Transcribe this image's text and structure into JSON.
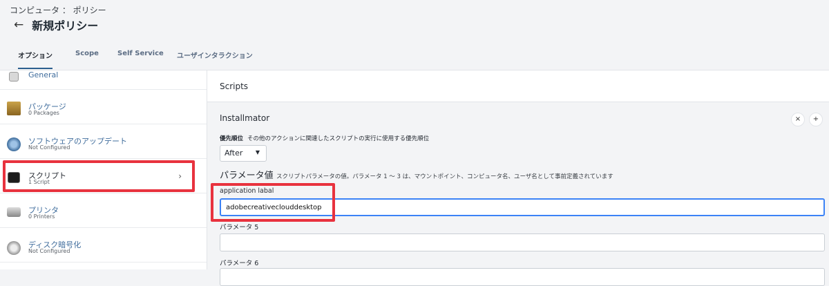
{
  "header": {
    "breadcrumb": "コンピュータ ： ポリシー",
    "back_icon": "←",
    "title": "新規ポリシー"
  },
  "tabs": [
    {
      "label": "オプション",
      "active": true
    },
    {
      "label": "Scope",
      "active": false
    },
    {
      "label": "Self Service",
      "active": false
    },
    {
      "label": "ユーザインタラクション",
      "active": false
    }
  ],
  "sidebar": {
    "items": [
      {
        "title": "General",
        "subtitle": "",
        "icon": "general-icon"
      },
      {
        "title": "パッケージ",
        "subtitle": "0 Packages",
        "icon": "package-icon"
      },
      {
        "title": "ソフトウェアのアップデート",
        "subtitle": "Not Configured",
        "icon": "software-update-icon"
      },
      {
        "title": "スクリプト",
        "subtitle": "1 Script",
        "icon": "terminal-icon",
        "selected": true
      },
      {
        "title": "プリンタ",
        "subtitle": "0 Printers",
        "icon": "printer-icon"
      },
      {
        "title": "ディスク暗号化",
        "subtitle": "Not Configured",
        "icon": "disk-encryption-icon"
      }
    ],
    "chevron": "›"
  },
  "main": {
    "section_title": "Scripts",
    "script_name": "Installmator",
    "close_symbol": "×",
    "add_symbol": "+",
    "priority_label": "優先順位",
    "priority_desc": "その他のアクションに関連したスクリプトの実行に使用する優先順位",
    "priority_value": "After",
    "caret": "▼",
    "params_heading": "パラメータ値",
    "params_desc": "スクリプトパラメータの値。パラメータ 1 〜 3 は、マウントポイント、コンピュータ名、ユーザ名として事前定義されています",
    "fields": [
      {
        "label": "application labal",
        "value": "adobecreativeclouddesktop"
      },
      {
        "label": "パラメータ 5",
        "value": ""
      },
      {
        "label": "パラメータ 6",
        "value": ""
      }
    ]
  },
  "colors": {
    "highlight": "#e8323e",
    "link": "#3f6c9c",
    "focus": "#3b82f6"
  }
}
